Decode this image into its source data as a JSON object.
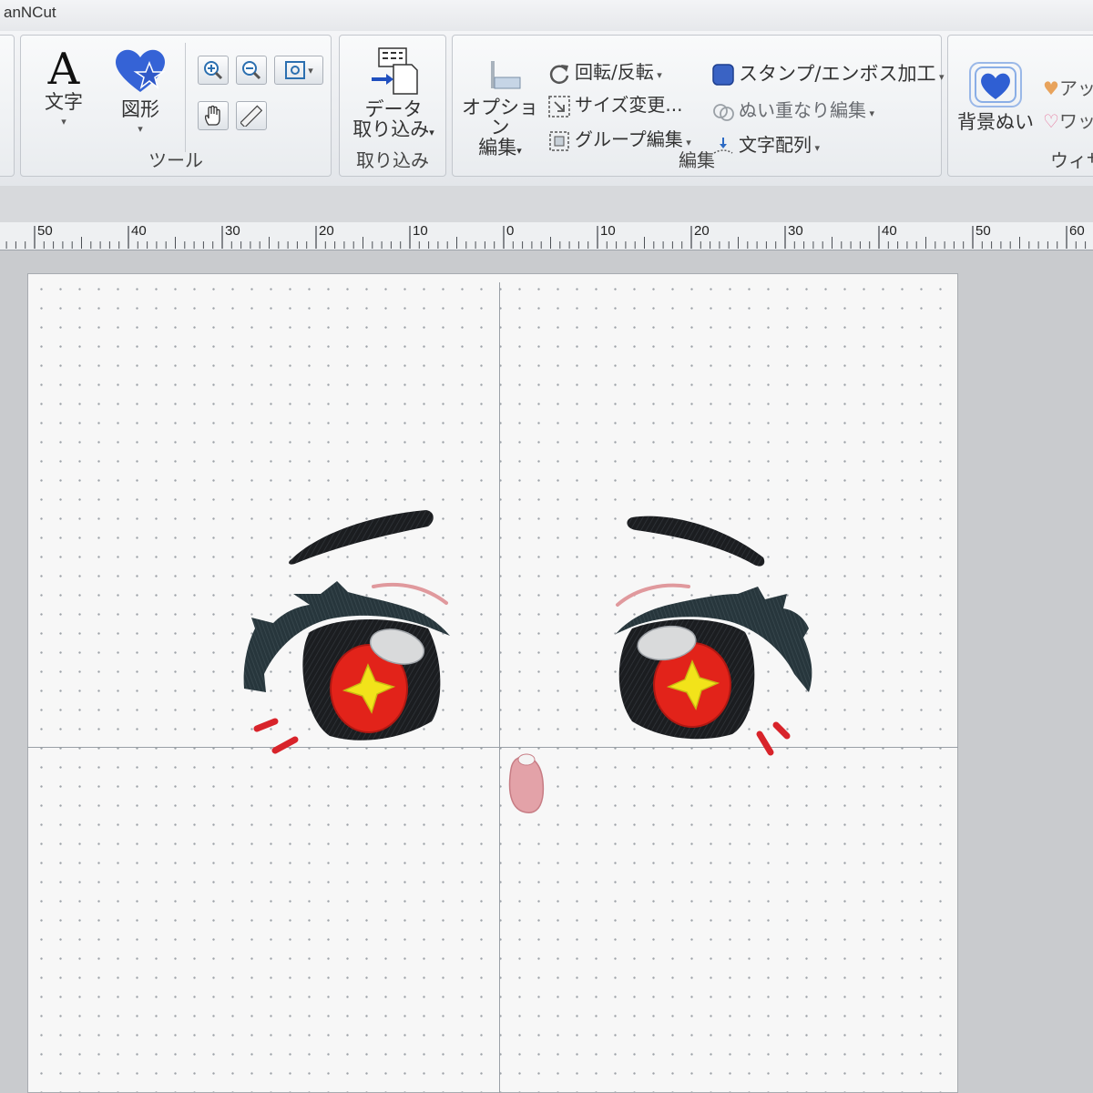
{
  "app": {
    "title": "anNCut"
  },
  "ribbon": {
    "tool_group": {
      "label": "ツール",
      "text_button": "文字",
      "shape_button": "図形"
    },
    "import_group": {
      "label": "取り込み",
      "data_import_line1": "データ",
      "data_import_line2": "取り込み"
    },
    "edit_group": {
      "label": "編集",
      "option_edit_line1": "オプション",
      "option_edit_line2": "編集",
      "rotate_flip": "回転/反転",
      "resize": "サイズ変更...",
      "group_edit": "グループ編集",
      "stamp_emboss": "スタンプ/エンボス加工",
      "stitch_overlap": "ぬい重なり編集",
      "text_layout": "文字配列"
    },
    "wizard_group": {
      "label": "ウィザ",
      "background_stitch": "背景ぬい",
      "applique": "アッ",
      "wappen": "ワッ"
    }
  },
  "ruler": {
    "labels_left": [
      "50",
      "40",
      "30",
      "20",
      "10"
    ],
    "label_zero": "0",
    "labels_right": [
      "10",
      "20",
      "30",
      "40",
      "50",
      "60"
    ]
  },
  "colors": {
    "outline_black": "#1b1d20",
    "eye_shadow": "#2b3a3f",
    "iris_red": "#e2231a",
    "star_yellow": "#f2e31a",
    "highlight_gray": "#d9dadb",
    "blush_red": "#d8232a",
    "mouth_pink": "#e3a2a8",
    "crease_pink": "#e0999d"
  }
}
